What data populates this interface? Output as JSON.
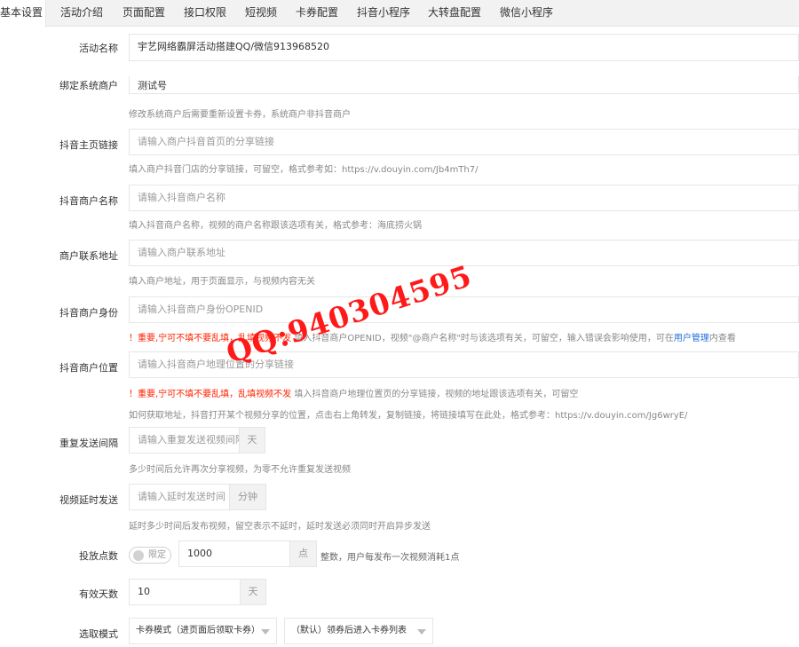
{
  "tabs": [
    {
      "label": "基本设置",
      "active": true
    },
    {
      "label": "活动介绍"
    },
    {
      "label": "页面配置"
    },
    {
      "label": "接口权限"
    },
    {
      "label": "短视频"
    },
    {
      "label": "卡券配置"
    },
    {
      "label": "抖音小程序"
    },
    {
      "label": "大转盘配置"
    },
    {
      "label": "微信小程序"
    }
  ],
  "fields": {
    "activity_name": {
      "label": "活动名称",
      "value": "宇艺网络霸屏活动搭建QQ/微信913968520"
    },
    "system_merchant": {
      "label": "绑定系统商户",
      "value": "测试号",
      "help": "修改系统商户后需要重新设置卡券，系统商户非抖音商户"
    },
    "douyin_home": {
      "label": "抖音主页链接",
      "placeholder": "请输入商户抖音首页的分享链接",
      "help": "填入商户抖音门店的分享链接，可留空，格式参考如：https://v.douyin.com/Jb4mTh7/"
    },
    "douyin_name": {
      "label": "抖音商户名称",
      "placeholder": "请输入抖音商户名称",
      "help": "填入抖音商户名称，视频的商户名称跟该选项有关，格式参考：海底捞火锅"
    },
    "contact_address": {
      "label": "商户联系地址",
      "placeholder": "请输入商户联系地址",
      "help": "填入商户地址，用于页面显示，与视频内容无关"
    },
    "douyin_identity": {
      "label": "抖音商户身份",
      "placeholder": "请输入抖音商户身份OPENID",
      "help_warn": "！重要,宁可不填不要乱填，乱填视频不发",
      "help_text": " 填入抖音商户OPENID，视频\"@商户名称\"时与该选项有关，可留空，输入错误会影响使用，可在",
      "help_link": "用户管理",
      "help_tail": "内查看"
    },
    "douyin_location": {
      "label": "抖音商户位置",
      "placeholder": "请输入抖音商户地理位置的分享链接",
      "help_warn": "！重要,宁可不填不要乱填，乱填视频不发",
      "help_text": " 填入抖音商户地理位置页的分享链接，视频的地址跟该选项有关，可留空",
      "help2": "如何获取地址，抖音打开某个视频分享的位置，点击右上角转发，复制链接，将链接填写在此处，格式参考：https://v.douyin.com/Jg6wryE/"
    },
    "repeat_interval": {
      "label": "重复发送间隔",
      "placeholder": "请输入重复发送视频间隔",
      "addon": "天",
      "help": "多少时间后允许再次分享视频，为零不允许重复发送视频"
    },
    "video_delay": {
      "label": "视频延时发送",
      "placeholder": "请输入延时发送时间",
      "addon": "分钟",
      "help": "延时多少时间后发布视频，留空表示不延时，延时发送必须同时开启异步发送"
    },
    "points": {
      "label": "投放点数",
      "switch_label": "限定",
      "value": "1000",
      "addon": "点",
      "help": "整数，用户每发布一次视频消耗1点"
    },
    "valid_days": {
      "label": "有效天数",
      "value": "10",
      "addon": "天"
    },
    "pick_mode": {
      "label": "选取模式",
      "select1": "卡券模式（进页面后领取卡券）",
      "select2": "（默认）领券后进入卡券列表"
    }
  },
  "watermark": "QQ:940304595",
  "colors": {
    "warning": "#ff2200",
    "link": "#1e6fd9",
    "watermark": "#ff1a1a"
  }
}
